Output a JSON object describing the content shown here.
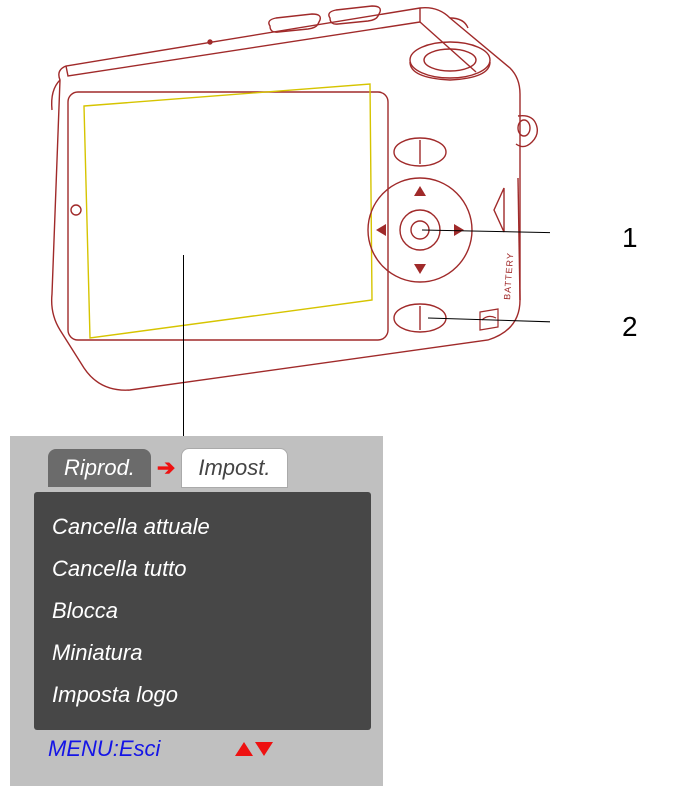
{
  "callouts": {
    "c1": "1",
    "c2": "2"
  },
  "tabs": {
    "active": "Riprod.",
    "arrow": "→",
    "inactive": "Impost."
  },
  "menu": {
    "items": [
      "Cancella attuale",
      "Cancella tutto",
      "Blocca",
      "Miniatura",
      "Imposta logo"
    ]
  },
  "footer": {
    "label": "MENU:Esci"
  }
}
